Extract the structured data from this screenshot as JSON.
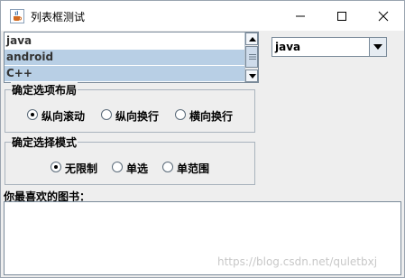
{
  "window": {
    "title": "列表框测试"
  },
  "listbox": {
    "items": [
      "java",
      "android",
      "C++"
    ],
    "selected": [
      false,
      true,
      true
    ]
  },
  "combo": {
    "value": "java"
  },
  "layout_group": {
    "title": "确定选项布局",
    "options": [
      "纵向滚动",
      "纵向换行",
      "横向换行"
    ],
    "selected_index": 0
  },
  "mode_group": {
    "title": "确定选择模式",
    "options": [
      "无限制",
      "单选",
      "单范围"
    ],
    "selected_index": 0
  },
  "books": {
    "label": "你最喜欢的图书：",
    "text": ""
  },
  "watermark": "https://blog.csdn.net/quletbxj",
  "colors": {
    "selection": "#b8cfe5",
    "background": "#eeeeee"
  },
  "icons": {
    "app": "java-cup-icon",
    "minimize": "minimize-icon",
    "maximize": "maximize-icon",
    "close": "close-icon"
  }
}
